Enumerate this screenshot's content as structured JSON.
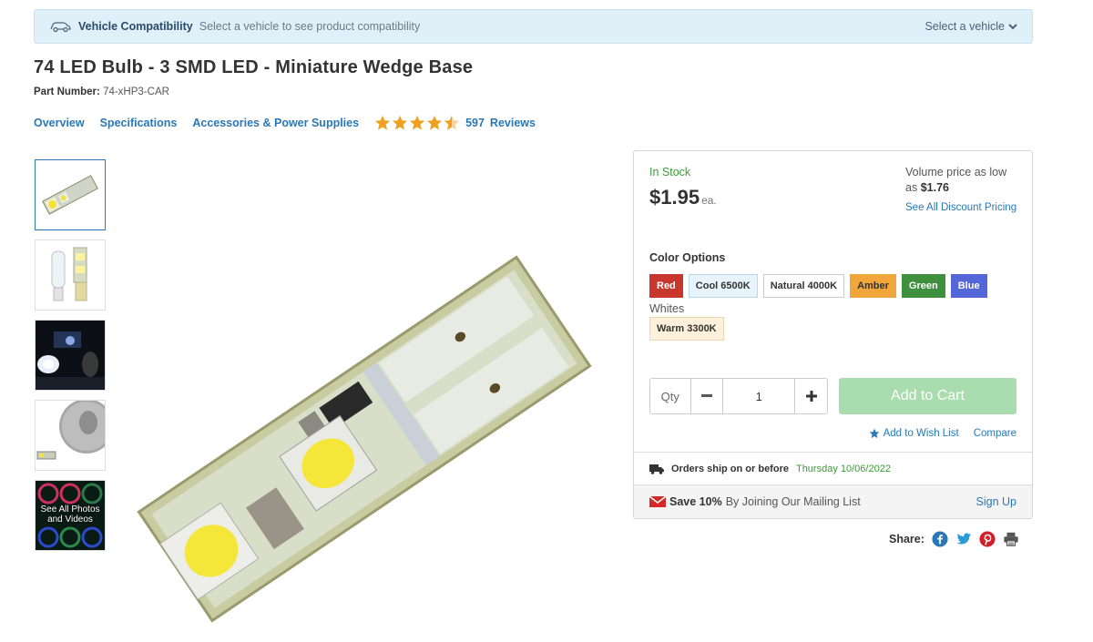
{
  "vehicle_bar": {
    "title": "Vehicle Compatibility",
    "text": "Select a vehicle to see product compatibility",
    "select_label": "Select a vehicle",
    "car_icon": "car-icon",
    "chevron_icon": "chevron-down-icon"
  },
  "product": {
    "title": "74 LED Bulb - 3 SMD LED - Miniature Wedge Base",
    "part_number_label": "Part Number:",
    "part_number": "74-xHP3-CAR"
  },
  "tabs": {
    "overview": "Overview",
    "specifications": "Specifications",
    "accessories": "Accessories & Power Supplies",
    "rating": 4.5,
    "rating_max": 5,
    "review_count": "597",
    "reviews_label": "Reviews"
  },
  "thumbnails": {
    "see_all": "See All Photos and Videos"
  },
  "buybox": {
    "stock": "In Stock",
    "price": "$1.95",
    "price_unit": "ea.",
    "volume_text": "Volume price as low as",
    "volume_price": "$1.76",
    "discount_link": "See All Discount Pricing",
    "color_options_label": "Color Options",
    "swatches": [
      {
        "label": "Red",
        "bg": "#c8372d",
        "fg": "#ffffff"
      },
      {
        "label": "Cool 6500K",
        "bg": "#e8f4fb",
        "fg": "#333333"
      },
      {
        "label": "Natural 4000K",
        "bg": "#ffffff",
        "fg": "#333333"
      },
      {
        "label": "Amber",
        "bg": "#f0a63a",
        "fg": "#333333"
      },
      {
        "label": "Green",
        "bg": "#3f8f3f",
        "fg": "#ffffff"
      },
      {
        "label": "Blue",
        "bg": "#5566d8",
        "fg": "#ffffff"
      }
    ],
    "whites_label": "Whites",
    "warm_swatch": {
      "label": "Warm 3300K",
      "bg": "#fdf1dc",
      "fg": "#333333"
    },
    "qty_label": "Qty",
    "qty_value": "1",
    "minus_icon": "minus-icon",
    "plus_icon": "plus-icon",
    "add_to_cart": "Add to Cart",
    "wish_list": "Add to Wish List",
    "compare": "Compare",
    "ship_label": "Orders ship on or before",
    "ship_date": "Thursday 10/06/2022",
    "save_bold": "Save 10%",
    "save_text": "By Joining Our Mailing List",
    "sign_up": "Sign Up"
  },
  "share": {
    "label": "Share:",
    "icons": [
      "facebook-icon",
      "twitter-icon",
      "pinterest-icon",
      "print-icon"
    ]
  },
  "colors": {
    "link": "#2a78b6",
    "star": "#f0a020",
    "stock_green": "#3a9c3a",
    "cart_button": "#a9dcae",
    "vehicle_bar_bg": "#dff0f9"
  }
}
